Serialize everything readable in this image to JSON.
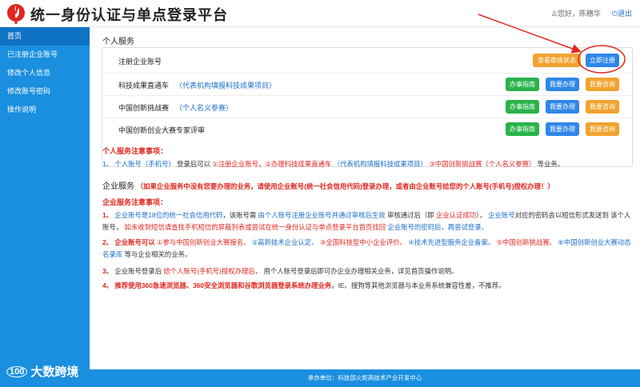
{
  "header": {
    "title": "统一身份认证与单点登录平台",
    "greeting": "您好，陈穗华",
    "logout": "退出"
  },
  "sidebar": {
    "items": [
      {
        "label": "首页"
      },
      {
        "label": "已注册企业账号"
      },
      {
        "label": "修改个人信息"
      },
      {
        "label": "修改账号密码"
      },
      {
        "label": "操作说明"
      }
    ],
    "watermark": "大数跨境",
    "watermark_mark": "100"
  },
  "personal": {
    "title": "个人服务",
    "rows": [
      {
        "label": "注册企业账号",
        "sub": "",
        "btns": [
          "查看审核状态",
          "立即注册"
        ]
      },
      {
        "label": "科技成果直通车",
        "sub": "（代表机构填报科技成果项目）",
        "btns": [
          "办事指南",
          "我要办理",
          "我要咨询"
        ]
      },
      {
        "label": "中国创新挑战赛",
        "sub": "（个人名义参赛）",
        "btns": [
          "办事指南",
          "我要办理",
          "我要咨询"
        ]
      },
      {
        "label": "中国创新创业大赛专家评审",
        "sub": "",
        "btns": [
          "办事指南",
          "我要办理",
          "我要咨询"
        ]
      }
    ],
    "notes_title": "个人服务注意事项：",
    "note1": {
      "a": "1、 个人账号（手机号）",
      "b": "登录后可以",
      "c": "①注册企业账号，②办理科技成果直通车",
      "d": "（代表机构填报科技成果项目）",
      "e": "③中国创新挑战赛（个人名义参赛）",
      "f": "等业务。"
    }
  },
  "enterprise": {
    "title": "企业服务",
    "subtitle": "（如果企业服务中没有您要办理的业务，请使用企业账号(统一社会信用代码)登录办理，或者由企业账号给您的个人账号(手机号)授权办理！）",
    "notes_title": "企业服务注意事项：",
    "n1": {
      "a": "1、",
      "b": "企业账号是18位的统一社会信用代码",
      "c": "，该账号需",
      "d": "由个人账号注册企业账号并通过审核后生效",
      "e": "审核通过后（即",
      "f": "企业认证成功",
      "g": "），",
      "h": "企业账号",
      "i": "对应的密码会以短信形式发送到",
      "j": "该个人账号，",
      "k": "如未收到短信请查找手机短信的屏蔽列表或尝试在统一身份认证与单点登录平台首页找回",
      "l": "企业账号的密码后，再尝试登录。"
    },
    "n2": {
      "a": "2、 企业账号可以",
      "b": "①参与中国创新创业大赛报名、",
      "c": "②高新技术企业认定、",
      "d": "③全国科技型中小企业评价、",
      "e": "④技术先进型服务企业备案、",
      "f": "⑤中国创新挑战赛、",
      "g": "⑥中国创新创业大赛动态名录库",
      "h": "等与企业相关的业务。"
    },
    "n3": {
      "a": "3、",
      "b": "企业账号登录后",
      "c": "给个人账号(手机号)授权办理后，",
      "d": "用个人账号登录后即可办企业办理相关业务，详见首页操作说明。"
    },
    "n4": {
      "a": "4、",
      "b": "推荐使用360急速浏览器、360安全浏览器和谷歌浏览器登录系统办理业务",
      "c": "，IE、搜狗等其他浏览器与本业务系统兼容性差，不推荐。"
    }
  },
  "footer": {
    "text": "承办单位：科技部火炬高技术产业开发中心"
  },
  "colors": {
    "sidebar": "#1a8fe0",
    "accent_red": "#e0261f",
    "link_blue": "#1a6fc9"
  }
}
